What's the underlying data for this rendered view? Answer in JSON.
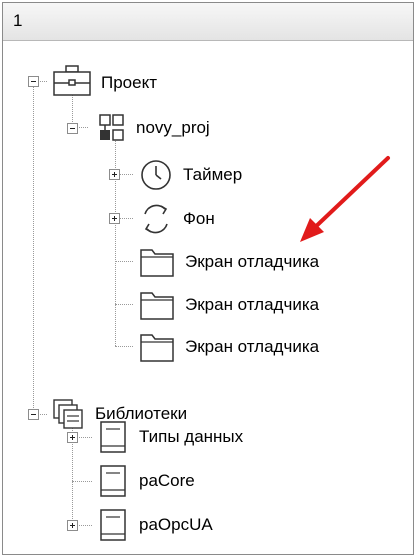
{
  "header": {
    "title": "1"
  },
  "tree": {
    "project": {
      "label": "Проект"
    },
    "novy_proj": {
      "label": "novy_proj"
    },
    "timer": {
      "label": "Таймер"
    },
    "fon": {
      "label": "Фон"
    },
    "screens": [
      {
        "label": "Экран отладчика"
      },
      {
        "label": "Экран отладчика"
      },
      {
        "label": "Экран отладчика"
      }
    ],
    "libraries": {
      "label": "Библиотеки"
    },
    "data_types": {
      "label": "Типы данных"
    },
    "pacore": {
      "label": "paCore"
    },
    "paopcua": {
      "label": "paOpcUA"
    }
  },
  "annotation": {
    "arrow_color": "#e11b1b"
  }
}
